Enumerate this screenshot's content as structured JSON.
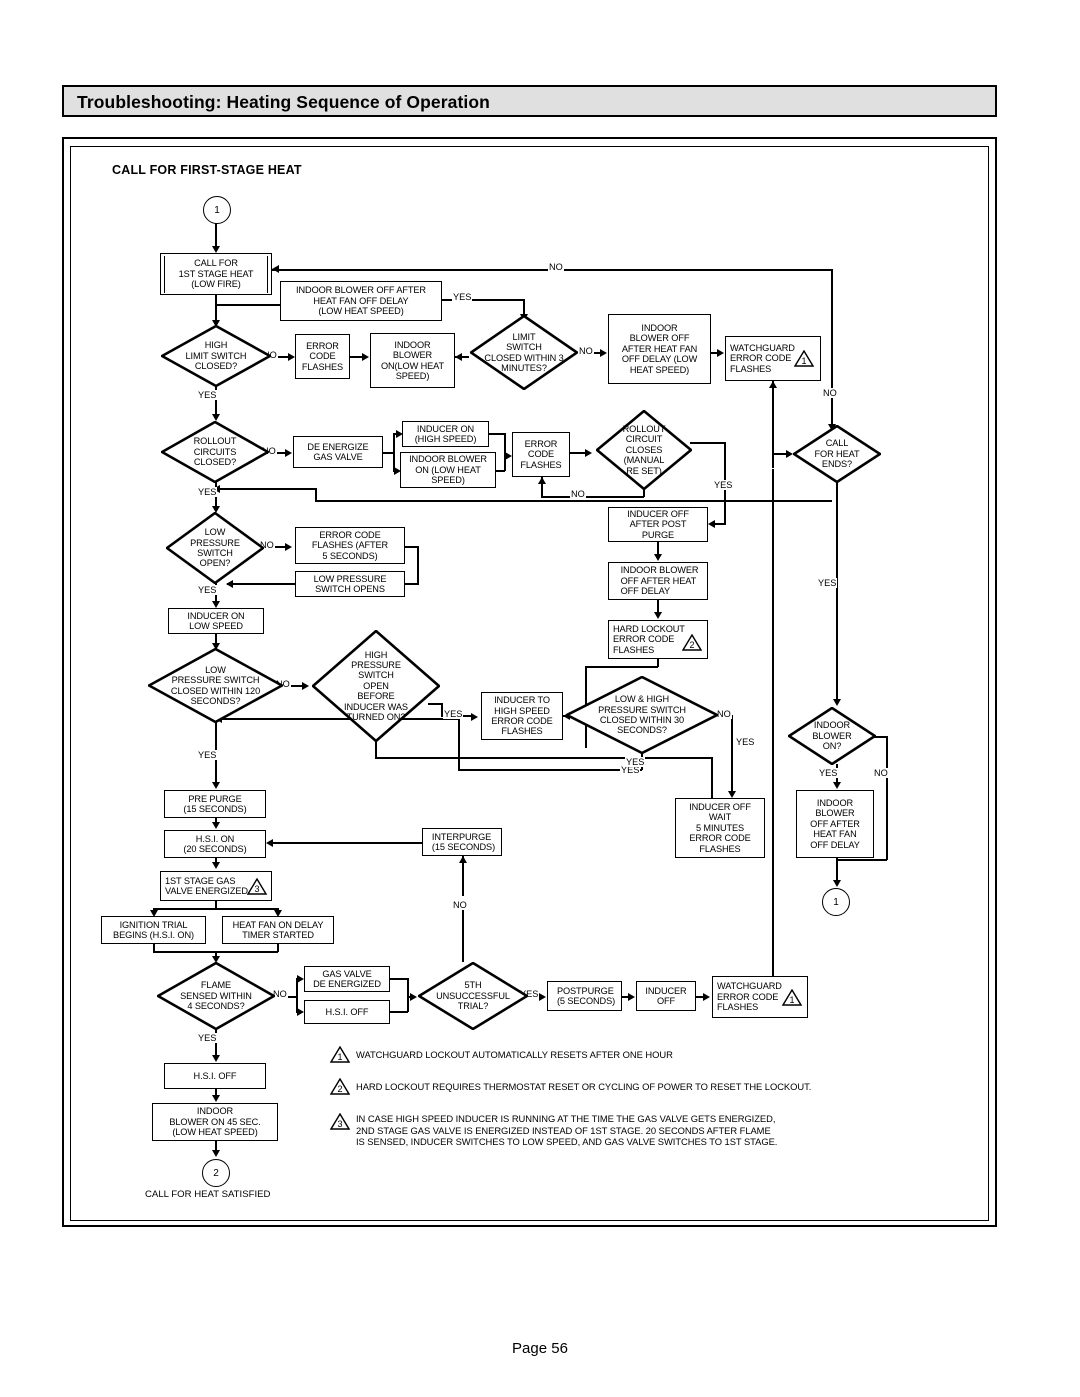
{
  "document": {
    "title": "Troubleshooting:  Heating Sequence of Operation",
    "page_footer": "Page 56",
    "section_label": "CALL FOR FIRST-STAGE HEAT"
  },
  "chart_data": {
    "type": "diagram",
    "subtype": "flowchart",
    "title": "Troubleshooting: Heating Sequence of Operation",
    "notes_count": 3
  },
  "nodes": {
    "start_connector": "1",
    "call_for_1st_stage": "CALL FOR\n1ST STAGE HEAT\n(LOW FIRE)",
    "indoor_blower_off_heatfan": "INDOOR BLOWER OFF AFTER\nHEAT FAN OFF DELAY\n(LOW HEAT SPEED)",
    "high_limit_switch": "HIGH\nLIMIT SWITCH\nCLOSED?",
    "error_code_flashes_1": "ERROR\nCODE\nFLASHES",
    "indoor_blower_on_low": "INDOOR\nBLOWER\nON(LOW HEAT\nSPEED)",
    "limit_switch_3min": "LIMIT\nSWITCH\nCLOSED WITHIN 3\nMINUTES?",
    "indoor_blower_off_delay": "INDOOR\nBLOWER OFF\nAFTER HEAT FAN\nOFF DELAY (LOW\nHEAT SPEED)",
    "watchguard_error_1": "WATCHGUARD\nERROR CODE\nFLASHES",
    "watchguard_error_1_badge": "1",
    "rollout_circuits_closed": "ROLLOUT\nCIRCUITS\nCLOSED?",
    "de_energize_gas_valve": "DE  ENERGIZE\nGAS VALVE",
    "inducer_on_high_speed": "INDUCER ON\n(HIGH SPEED)",
    "indoor_blower_on_low_heat": "INDOOR BLOWER\nON (LOW HEAT\nSPEED)",
    "error_code_flashes_2": "ERROR\nCODE\nFLASHES",
    "rollout_circuit_closes": "ROLLOUT\nCIRCUIT\nCLOSES\n(MANUAL\nRE  SET)",
    "call_for_heat_ends": "CALL\nFOR HEAT\nENDS?",
    "low_pressure_switch_open": "LOW\nPRESSURE\nSWITCH\nOPEN?",
    "error_code_after_5s": "ERROR CODE\nFLASHES (AFTER\n5 SECONDS)",
    "low_pressure_switch_opens": "LOW PRESSURE\nSWITCH OPENS",
    "inducer_off_after_post_purge": "INDUCER OFF\nAFTER POST\nPURGE",
    "indoor_blower_off_heat_delay": "INDOOR BLOWER\nOFF AFTER HEAT\nOFF DELAY",
    "hard_lockout_error": "HARD LOCKOUT\nERROR CODE\nFLASHES",
    "hard_lockout_badge": "2",
    "inducer_on_low_speed": "INDUCER ON\nLOW SPEED",
    "low_ps_closed_120": "LOW\nPRESSURE SWITCH\nCLOSED WITHIN 120\nSECONDS?",
    "high_ps_open_before": "HIGH\nPRESSURE\nSWITCH\nOPEN\nBEFORE\nINDUCER WAS\nTURNED ON?",
    "inducer_to_high_speed": "INDUCER TO\nHIGH SPEED\nERROR CODE\nFLASHES",
    "low_high_ps_30": "LOW & HIGH\nPRESSURE SWITCH\nCLOSED WITHIN 30\nSECONDS?",
    "indoor_blower_on_q": "INDOOR\nBLOWER\nON?",
    "pre_purge": "PRE  PURGE\n(15 SECONDS)",
    "hsi_on_20s": "H.S.I. ON\n(20 SECONDS)",
    "interpurge": "INTERPURGE\n(15 SECONDS)",
    "inducer_off_wait_5min": "INDUCER OFF\nWAIT\n5 MINUTES\nERROR CODE\nFLASHES",
    "indoor_blower_off_after_heat_fan": "INDOOR\nBLOWER\nOFF AFTER\nHEAT FAN\nOFF DELAY",
    "return_connector_1": "1",
    "first_stage_gas_valve": "1ST STAGE GAS\nVALVE ENERGIZED",
    "first_stage_gas_valve_badge": "3",
    "ignition_trial_begins": "IGNITION TRIAL\nBEGINS (H.S.I. ON)",
    "heat_fan_on_delay": "HEAT FAN ON DELAY\nTIMER STARTED",
    "flame_sensed_4s": "FLAME\nSENSED WITHIN\n4 SECONDS?",
    "gas_valve_de_energized": "GAS VALVE\nDE  ENERGIZED",
    "hsi_off_trial": "H.S.I. OFF",
    "fifth_unsuccessful_trial": "5TH\nUNSUCCESSFUL\nTRIAL?",
    "postpurge": "POSTPURGE\n(5 SECONDS)",
    "inducer_off": "INDUCER\nOFF",
    "watchguard_error_2": "WATCHGUARD\nERROR CODE\nFLASHES",
    "watchguard_error_2_badge": "1",
    "hsi_off_final": "H.S.I. OFF",
    "indoor_blower_on_45": "INDOOR\nBLOWER ON 45 SEC.\n(LOW HEAT SPEED)",
    "end_connector": "2",
    "end_caption": "CALL FOR HEAT SATISFIED"
  },
  "edge_labels": {
    "no_top": "NO",
    "yes_limit_in": "YES",
    "no_high_limit": "NO",
    "no_limit_3min": "NO",
    "yes_high_limit": "YES",
    "no_rollout": "NO",
    "yes_rollout": "YES",
    "no_rollout_circuit": "NO",
    "yes_rollout_circuit": "YES",
    "no_watchguard": "NO",
    "no_low_ps_open": "NO",
    "yes_low_ps_open": "YES",
    "yes_call_heat_ends": "YES",
    "no_low_ps_120": "NO",
    "yes_low_ps_120": "YES",
    "yes_high_ps_open": "YES",
    "no_low_high_ps": "NO",
    "yes_low_high_ps": "YES",
    "yes_inducer_wait": "YES",
    "no_interpurge": "NO",
    "no_fifth_trial": "NO",
    "yes_indoor_blower_on": "YES",
    "no_indoor_blower_on": "NO",
    "no_flame": "NO",
    "yes_flame": "YES",
    "yes_fifth_trial": "YES"
  },
  "notes": [
    {
      "num": "1",
      "text": "WATCHGUARD LOCKOUT AUTOMATICALLY RESETS AFTER ONE HOUR"
    },
    {
      "num": "2",
      "text": "HARD LOCKOUT REQUIRES THERMOSTAT RESET OR CYCLING OF POWER TO RESET THE LOCKOUT."
    },
    {
      "num": "3",
      "text": "IN CASE HIGH SPEED INDUCER IS RUNNING AT THE TIME THE GAS VALVE GETS ENERGIZED,\n2ND STAGE GAS VALVE IS ENERGIZED INSTEAD OF 1ST STAGE. 20 SECONDS AFTER FLAME\nIS SENSED, INDUCER SWITCHES TO LOW SPEED, AND GAS VALVE SWITCHES TO 1ST STAGE."
    }
  ],
  "colors": {
    "title_bg": "#e0e0e0",
    "line": "#000000",
    "page_bg": "#ffffff"
  }
}
